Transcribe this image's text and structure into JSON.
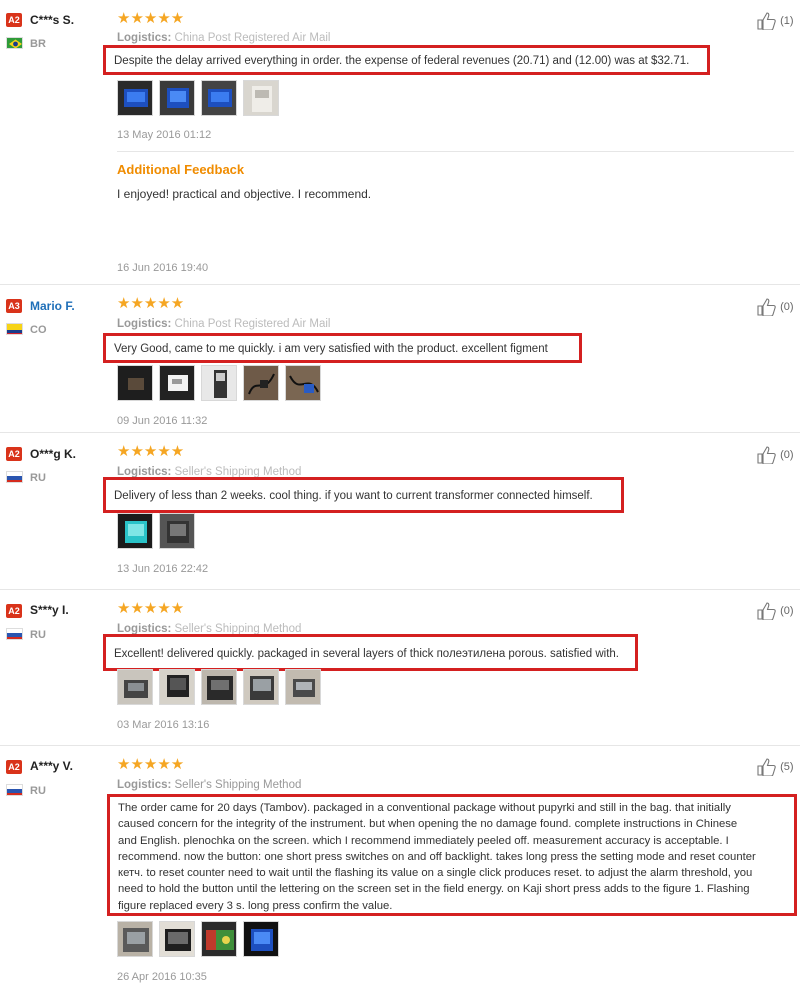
{
  "reviews": [
    {
      "badge": "A2",
      "name": "C***s S.",
      "country": "BR",
      "stars": "★★★★★",
      "logistics_label": "Logistics:",
      "logistics_value": "China Post Registered Air Mail",
      "text": "Despite the delay arrived everything in order. the expense of federal revenues (20.71) and (12.00) was at $32.71.",
      "date": "13 May 2016 01:12",
      "likes": "(1)",
      "thumbs": [
        "device-blue-screen",
        "device-blue-screen",
        "device-blue-screen",
        "device-white"
      ],
      "additional": {
        "title": "Additional Feedback",
        "text": "I enjoyed! practical and objective. I recommend.",
        "date": "16 Jun 2016 19:40"
      }
    },
    {
      "badge": "A3",
      "name": "Mario F.",
      "country": "CO",
      "stars": "★★★★★",
      "logistics_label": "Logistics:",
      "logistics_value": "China Post Registered Air Mail",
      "text": "Very Good, came to me quickly. i am very satisfied with the product. excellent figment",
      "date": "09 Jun 2016 11:32",
      "likes": "(0)",
      "thumbs": [
        "device-dark",
        "device-white",
        "device-grey",
        "cables",
        "cables"
      ]
    },
    {
      "badge": "A2",
      "name": "O***g K.",
      "country": "RU",
      "stars": "★★★★★",
      "logistics_label": "Logistics:",
      "logistics_value": "Seller's Shipping Method",
      "text": "Delivery of less than 2 weeks. cool thing. if you want to current transformer connected himself.",
      "date": "13 Jun 2016 22:42",
      "likes": "(0)",
      "thumbs": [
        "device-teal-screen",
        "device-grey"
      ]
    },
    {
      "badge": "A2",
      "name": "S***y I.",
      "country": "RU",
      "stars": "★★★★★",
      "logistics_label": "Logistics:",
      "logistics_value": "Seller's Shipping Method",
      "text": "Excellent! delivered quickly. packaged in several layers of thick полеэтилена porous. satisfied with.",
      "date": "03 Mar 2016 13:16",
      "likes": "(0)",
      "thumbs": [
        "device-grey",
        "device-dark",
        "device-dark",
        "device-grey",
        "device-grey"
      ]
    },
    {
      "badge": "A2",
      "name": "A***y V.",
      "country": "RU",
      "stars": "★★★★★",
      "logistics_label": "Logistics:",
      "logistics_value": "Seller's Shipping Method",
      "text_lines": [
        "The order came for 20 days (Tambov). packaged in a conventional package without pupyrki and still in the bag. that initially",
        "caused concern for the integrity of the instrument. but when opening the no damage found. complete instructions in Chinese",
        "and English. plenochka on the screen. which I recommend immediately peeled off. measurement accuracy is acceptable. I",
        "recommend. now the button: one short press switches on and off backlight. takes long press the setting mode and reset counter",
        "кетч. to reset counter need to wait until the flashing its value on a single click produces reset. to adjust the alarm threshold, you",
        "need to hold the button until the lettering on the screen set in the field energy. on Kaji short press adds to the figure 1. Flashing",
        "figure replaced every 3 s. long press confirm the value."
      ],
      "date": "26 Apr 2016 10:35",
      "likes": "(5)",
      "thumbs": [
        "device-grey",
        "device-dark",
        "device-green-red",
        "device-blue-screen"
      ]
    }
  ],
  "colors": {
    "badge": "#d9331a",
    "highlight": "#d42020",
    "stars": "#f5a623",
    "additional": "#f08c00",
    "link": "#1f6fb8"
  }
}
